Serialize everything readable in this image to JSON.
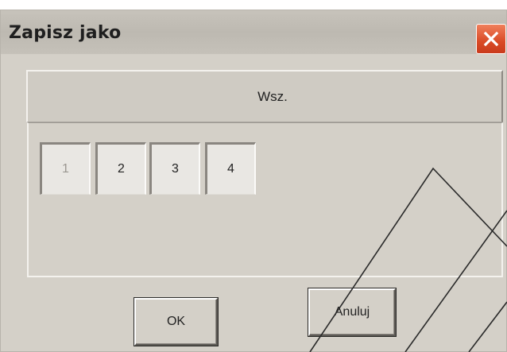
{
  "window": {
    "title": "Zapisz jako"
  },
  "tabs": {
    "all_label": "Wsz."
  },
  "pages": [
    {
      "label": "1",
      "enabled": false
    },
    {
      "label": "2",
      "enabled": true
    },
    {
      "label": "3",
      "enabled": true
    },
    {
      "label": "4",
      "enabled": true
    }
  ],
  "buttons": {
    "ok_label": "OK",
    "cancel_label": "Anuluj"
  },
  "icons": {
    "close": "close-icon"
  },
  "colors": {
    "window_bg": "#d4d0c8",
    "close_button": "#d94a26"
  }
}
